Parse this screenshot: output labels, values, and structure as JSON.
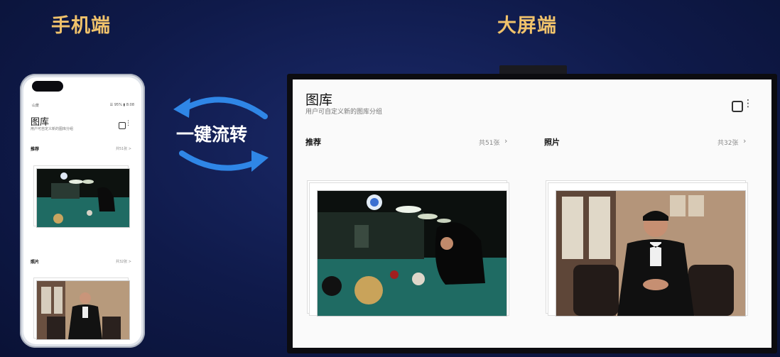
{
  "headings": {
    "phone": "手机端",
    "tv": "大屏端"
  },
  "center": {
    "label": "一键流转"
  },
  "phone": {
    "status_left": "山景",
    "status_right": "☰ 95% ▮ 8:08",
    "title": "图库",
    "subtitle": "用户可自定义新的图库分组",
    "sections": [
      {
        "label": "推荐",
        "count": "共51张 >"
      },
      {
        "label": "照片",
        "count": "共32张 >"
      }
    ]
  },
  "tv": {
    "title": "图库",
    "subtitle": "用户可自定义新的图库分组",
    "sections": [
      {
        "label": "推荐",
        "count": "共51张"
      },
      {
        "label": "照片",
        "count": "共32张"
      }
    ]
  },
  "icons": {
    "arrow_color": "#2f86e6",
    "gallery": "gallery-icon",
    "more": "more-vertical-icon"
  },
  "colors": {
    "heading": "#f0c26b",
    "background": "#0f1a4a"
  }
}
